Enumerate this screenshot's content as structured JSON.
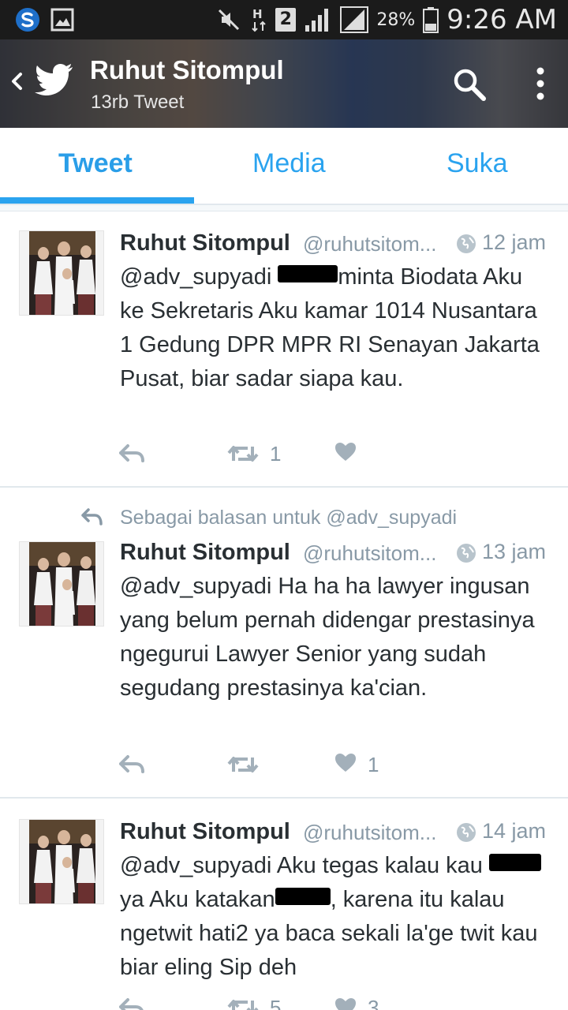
{
  "status_bar": {
    "time": "9:26 AM",
    "battery": "28%",
    "sim_badge": "2",
    "net": "H"
  },
  "header": {
    "title": "Ruhut Sitompul",
    "subtitle": "13rb Tweet"
  },
  "tabs": [
    {
      "label": "Tweet",
      "active": true
    },
    {
      "label": "Media",
      "active": false
    },
    {
      "label": "Suka",
      "active": false
    }
  ],
  "tweets": [
    {
      "name": "Ruhut Sitompul",
      "handle": "@ruhutsitom...",
      "time": "12 jam",
      "text_a": "@adv_supyadi",
      "text_b": "minta Biodata Aku ke Sekretaris Aku kamar 1014 Nusantara 1 Gedung DPR MPR RI Senayan Jakarta Pusat, biar sadar siapa kau.",
      "retweets": "1",
      "likes": ""
    },
    {
      "reply_context": "Sebagai balasan untuk @adv_supyadi",
      "name": "Ruhut Sitompul",
      "handle": "@ruhutsitom...",
      "time": "13 jam",
      "text": "@adv_supyadi Ha ha ha lawyer ingusan yang belum pernah didengar prestasinya ngegurui Lawyer Senior yang sudah segudang prestasinya ka'cian.",
      "retweets": "",
      "likes": "1"
    },
    {
      "name": "Ruhut Sitompul",
      "handle": "@ruhutsitom...",
      "time": "14 jam",
      "text_a": "@adv_supyadi Aku tegas kalau kau",
      "text_b": "ya Aku katakan",
      "text_c": ", karena itu kalau ngetwit hati2 ya baca sekali la'ge twit kau biar eling Sip deh",
      "retweets": "5",
      "likes": "3"
    }
  ],
  "colors": {
    "accent": "#2aa3ef",
    "text": "#292f33",
    "muted": "#8899a6"
  }
}
